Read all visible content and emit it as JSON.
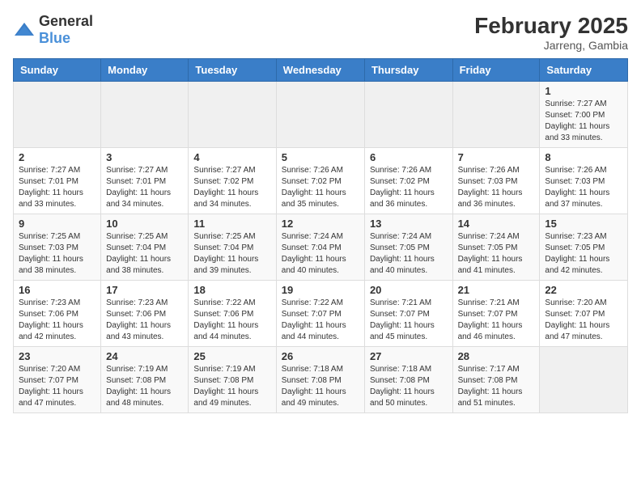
{
  "logo": {
    "general": "General",
    "blue": "Blue"
  },
  "title": {
    "month_year": "February 2025",
    "location": "Jarreng, Gambia"
  },
  "days_of_week": [
    "Sunday",
    "Monday",
    "Tuesday",
    "Wednesday",
    "Thursday",
    "Friday",
    "Saturday"
  ],
  "weeks": [
    [
      {
        "day": "",
        "empty": true
      },
      {
        "day": "",
        "empty": true
      },
      {
        "day": "",
        "empty": true
      },
      {
        "day": "",
        "empty": true
      },
      {
        "day": "",
        "empty": true
      },
      {
        "day": "",
        "empty": true
      },
      {
        "day": "1",
        "sunrise": "Sunrise: 7:27 AM",
        "sunset": "Sunset: 7:00 PM",
        "daylight": "Daylight: 11 hours and 33 minutes."
      }
    ],
    [
      {
        "day": "2",
        "sunrise": "Sunrise: 7:27 AM",
        "sunset": "Sunset: 7:01 PM",
        "daylight": "Daylight: 11 hours and 33 minutes."
      },
      {
        "day": "3",
        "sunrise": "Sunrise: 7:27 AM",
        "sunset": "Sunset: 7:01 PM",
        "daylight": "Daylight: 11 hours and 34 minutes."
      },
      {
        "day": "4",
        "sunrise": "Sunrise: 7:27 AM",
        "sunset": "Sunset: 7:02 PM",
        "daylight": "Daylight: 11 hours and 34 minutes."
      },
      {
        "day": "5",
        "sunrise": "Sunrise: 7:26 AM",
        "sunset": "Sunset: 7:02 PM",
        "daylight": "Daylight: 11 hours and 35 minutes."
      },
      {
        "day": "6",
        "sunrise": "Sunrise: 7:26 AM",
        "sunset": "Sunset: 7:02 PM",
        "daylight": "Daylight: 11 hours and 36 minutes."
      },
      {
        "day": "7",
        "sunrise": "Sunrise: 7:26 AM",
        "sunset": "Sunset: 7:03 PM",
        "daylight": "Daylight: 11 hours and 36 minutes."
      },
      {
        "day": "8",
        "sunrise": "Sunrise: 7:26 AM",
        "sunset": "Sunset: 7:03 PM",
        "daylight": "Daylight: 11 hours and 37 minutes."
      }
    ],
    [
      {
        "day": "9",
        "sunrise": "Sunrise: 7:25 AM",
        "sunset": "Sunset: 7:03 PM",
        "daylight": "Daylight: 11 hours and 38 minutes."
      },
      {
        "day": "10",
        "sunrise": "Sunrise: 7:25 AM",
        "sunset": "Sunset: 7:04 PM",
        "daylight": "Daylight: 11 hours and 38 minutes."
      },
      {
        "day": "11",
        "sunrise": "Sunrise: 7:25 AM",
        "sunset": "Sunset: 7:04 PM",
        "daylight": "Daylight: 11 hours and 39 minutes."
      },
      {
        "day": "12",
        "sunrise": "Sunrise: 7:24 AM",
        "sunset": "Sunset: 7:04 PM",
        "daylight": "Daylight: 11 hours and 40 minutes."
      },
      {
        "day": "13",
        "sunrise": "Sunrise: 7:24 AM",
        "sunset": "Sunset: 7:05 PM",
        "daylight": "Daylight: 11 hours and 40 minutes."
      },
      {
        "day": "14",
        "sunrise": "Sunrise: 7:24 AM",
        "sunset": "Sunset: 7:05 PM",
        "daylight": "Daylight: 11 hours and 41 minutes."
      },
      {
        "day": "15",
        "sunrise": "Sunrise: 7:23 AM",
        "sunset": "Sunset: 7:05 PM",
        "daylight": "Daylight: 11 hours and 42 minutes."
      }
    ],
    [
      {
        "day": "16",
        "sunrise": "Sunrise: 7:23 AM",
        "sunset": "Sunset: 7:06 PM",
        "daylight": "Daylight: 11 hours and 42 minutes."
      },
      {
        "day": "17",
        "sunrise": "Sunrise: 7:23 AM",
        "sunset": "Sunset: 7:06 PM",
        "daylight": "Daylight: 11 hours and 43 minutes."
      },
      {
        "day": "18",
        "sunrise": "Sunrise: 7:22 AM",
        "sunset": "Sunset: 7:06 PM",
        "daylight": "Daylight: 11 hours and 44 minutes."
      },
      {
        "day": "19",
        "sunrise": "Sunrise: 7:22 AM",
        "sunset": "Sunset: 7:07 PM",
        "daylight": "Daylight: 11 hours and 44 minutes."
      },
      {
        "day": "20",
        "sunrise": "Sunrise: 7:21 AM",
        "sunset": "Sunset: 7:07 PM",
        "daylight": "Daylight: 11 hours and 45 minutes."
      },
      {
        "day": "21",
        "sunrise": "Sunrise: 7:21 AM",
        "sunset": "Sunset: 7:07 PM",
        "daylight": "Daylight: 11 hours and 46 minutes."
      },
      {
        "day": "22",
        "sunrise": "Sunrise: 7:20 AM",
        "sunset": "Sunset: 7:07 PM",
        "daylight": "Daylight: 11 hours and 47 minutes."
      }
    ],
    [
      {
        "day": "23",
        "sunrise": "Sunrise: 7:20 AM",
        "sunset": "Sunset: 7:07 PM",
        "daylight": "Daylight: 11 hours and 47 minutes."
      },
      {
        "day": "24",
        "sunrise": "Sunrise: 7:19 AM",
        "sunset": "Sunset: 7:08 PM",
        "daylight": "Daylight: 11 hours and 48 minutes."
      },
      {
        "day": "25",
        "sunrise": "Sunrise: 7:19 AM",
        "sunset": "Sunset: 7:08 PM",
        "daylight": "Daylight: 11 hours and 49 minutes."
      },
      {
        "day": "26",
        "sunrise": "Sunrise: 7:18 AM",
        "sunset": "Sunset: 7:08 PM",
        "daylight": "Daylight: 11 hours and 49 minutes."
      },
      {
        "day": "27",
        "sunrise": "Sunrise: 7:18 AM",
        "sunset": "Sunset: 7:08 PM",
        "daylight": "Daylight: 11 hours and 50 minutes."
      },
      {
        "day": "28",
        "sunrise": "Sunrise: 7:17 AM",
        "sunset": "Sunset: 7:08 PM",
        "daylight": "Daylight: 11 hours and 51 minutes."
      },
      {
        "day": "",
        "empty": true
      }
    ]
  ]
}
